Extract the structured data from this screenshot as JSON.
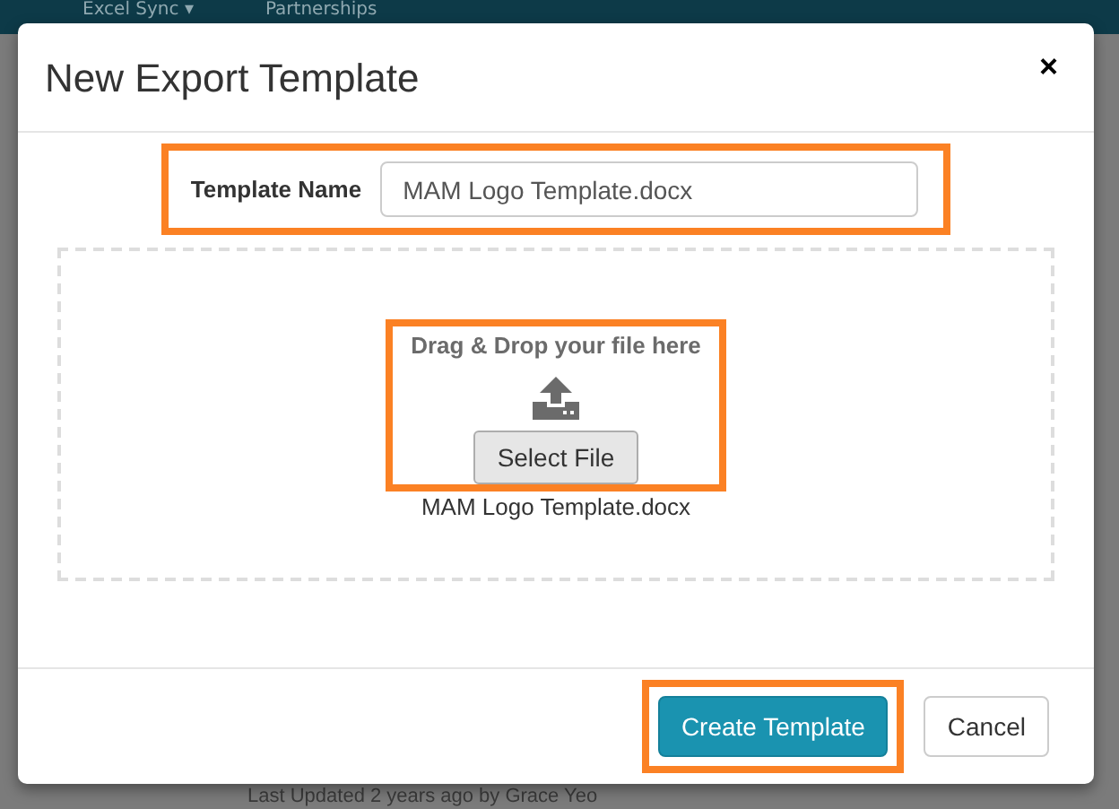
{
  "background": {
    "nav_items": [
      "Excel Sync ▾",
      "Partnerships"
    ],
    "footer_note": "Last Updated 2 years ago by Grace Yeo"
  },
  "dialog": {
    "title": "New Export Template",
    "close": "×",
    "template_name": {
      "label": "Template Name",
      "value": "MAM Logo Template.docx",
      "highlighted": true
    },
    "dropzone": {
      "prompt": "Drag & Drop your file here",
      "button": "Select File",
      "highlighted": true,
      "file_name": "MAM Logo Template.docx"
    },
    "buttons": [
      {
        "label": "Create Template",
        "kind": "primary",
        "highlighted": true
      },
      {
        "label": "Cancel",
        "kind": "default",
        "highlighted": false
      }
    ]
  }
}
